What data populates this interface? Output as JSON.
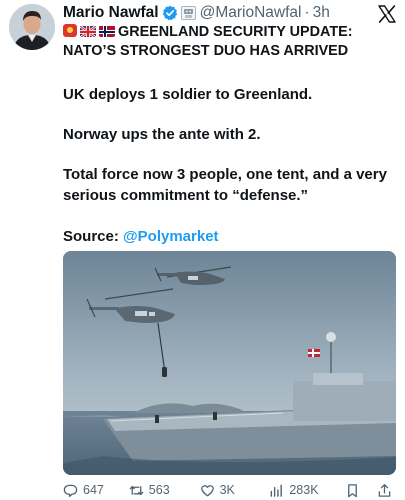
{
  "author": {
    "name": "Mario Nawfal",
    "handle": "@MarioNawfal",
    "separator": "·",
    "time": "3h"
  },
  "tweet": {
    "headline_line1": "GREENLAND SECURITY UPDATE:",
    "headline_line2": "NATO’S STRONGEST DUO HAS ARRIVED",
    "p1": "UK deploys 1 soldier to Greenland.",
    "p2": "Norway ups the ante with 2.",
    "p3": "Total force now 3 people, one tent, and a very serious commitment to “defense.”",
    "source_label": "Source:",
    "source_link": "@Polymarket"
  },
  "metrics": {
    "replies": "647",
    "reposts": "563",
    "likes": "3K",
    "views": "283K"
  },
  "icons": {
    "verified": "verified-badge-icon",
    "bot": "automated-account-icon",
    "x": "x-logo-icon",
    "siren": "siren-icon",
    "uk_flag": "uk-flag-icon",
    "norway_flag": "norway-flag-icon",
    "reply": "reply-icon",
    "repost": "repost-icon",
    "like": "heart-icon",
    "views": "views-icon",
    "bookmark": "bookmark-icon",
    "share": "share-icon"
  },
  "colors": {
    "text": "#0f1419",
    "secondary": "#536471",
    "link": "#1d9bf0",
    "verified": "#1d9bf0"
  }
}
